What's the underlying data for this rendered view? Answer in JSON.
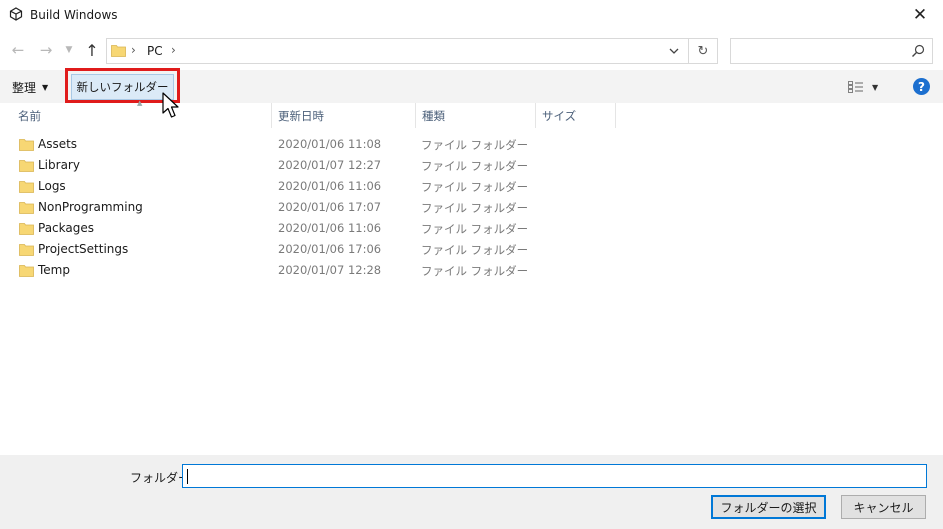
{
  "window": {
    "title": "Build Windows"
  },
  "nav": {
    "breadcrumb": [
      "PC"
    ],
    "search_placeholder": ""
  },
  "toolbar": {
    "organize_label": "整理",
    "new_folder_label": "新しいフォルダー"
  },
  "columns": {
    "name": "名前",
    "modified": "更新日時",
    "type": "種類",
    "size": "サイズ"
  },
  "files": [
    {
      "name": "Assets",
      "modified": "2020/01/06 11:08",
      "type": "ファイル フォルダー"
    },
    {
      "name": "Library",
      "modified": "2020/01/07 12:27",
      "type": "ファイル フォルダー"
    },
    {
      "name": "Logs",
      "modified": "2020/01/06 11:06",
      "type": "ファイル フォルダー"
    },
    {
      "name": "NonProgramming",
      "modified": "2020/01/06 17:07",
      "type": "ファイル フォルダー"
    },
    {
      "name": "Packages",
      "modified": "2020/01/06 11:06",
      "type": "ファイル フォルダー"
    },
    {
      "name": "ProjectSettings",
      "modified": "2020/01/06 17:06",
      "type": "ファイル フォルダー"
    },
    {
      "name": "Temp",
      "modified": "2020/01/07 12:28",
      "type": "ファイル フォルダー"
    }
  ],
  "footer": {
    "folder_label": "フォルダー:",
    "folder_value": "",
    "select_button": "フォルダーの選択",
    "cancel_button": "キャンセル"
  },
  "colors": {
    "highlight": "#e01b1b",
    "accent": "#0078d7",
    "folder": "#f7d774"
  },
  "icons": [
    "unity-icon",
    "close-icon",
    "back-arrow-icon",
    "forward-arrow-icon",
    "recent-locations-icon",
    "up-arrow-icon",
    "folder-icon",
    "chevron-right-icon",
    "chevron-down-icon",
    "refresh-icon",
    "search-icon",
    "view-options-icon",
    "help-icon",
    "mouse-cursor-icon"
  ]
}
